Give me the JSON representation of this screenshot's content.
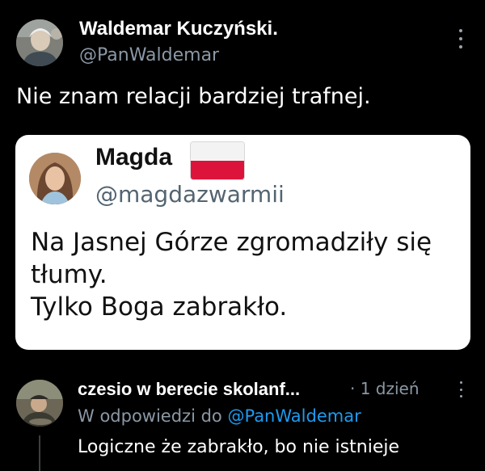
{
  "post": {
    "author_name": "Waldemar Kuczyński.",
    "author_handle": "@PanWaldemar",
    "text": "Nie znam relacji bardziej trafnej.",
    "menu_icon": "more-vertical-icon"
  },
  "quoted_post": {
    "author_name": "Magda",
    "author_emoji": "polish-flag-icon",
    "author_handle": "@magdazwarmii",
    "lines": [
      "Na Jasnej Górze zgromadziły się",
      "tłumy.",
      "Tylko Boga zabrakło."
    ],
    "background": "#ffffff"
  },
  "reply": {
    "author_name": "czesio w berecie skolanf...",
    "time": "· 1 dzień",
    "reply_prefix": "W odpowiedzi do",
    "reply_mention": "@PanWaldemar",
    "text": "Logiczne że zabrakło, bo nie istnieje",
    "menu_icon": "more-vertical-icon"
  },
  "colors": {
    "background": "#000000",
    "secondary_text": "#8b98a5",
    "mention": "#1d9bf0",
    "flag_red": "#dc143c"
  }
}
